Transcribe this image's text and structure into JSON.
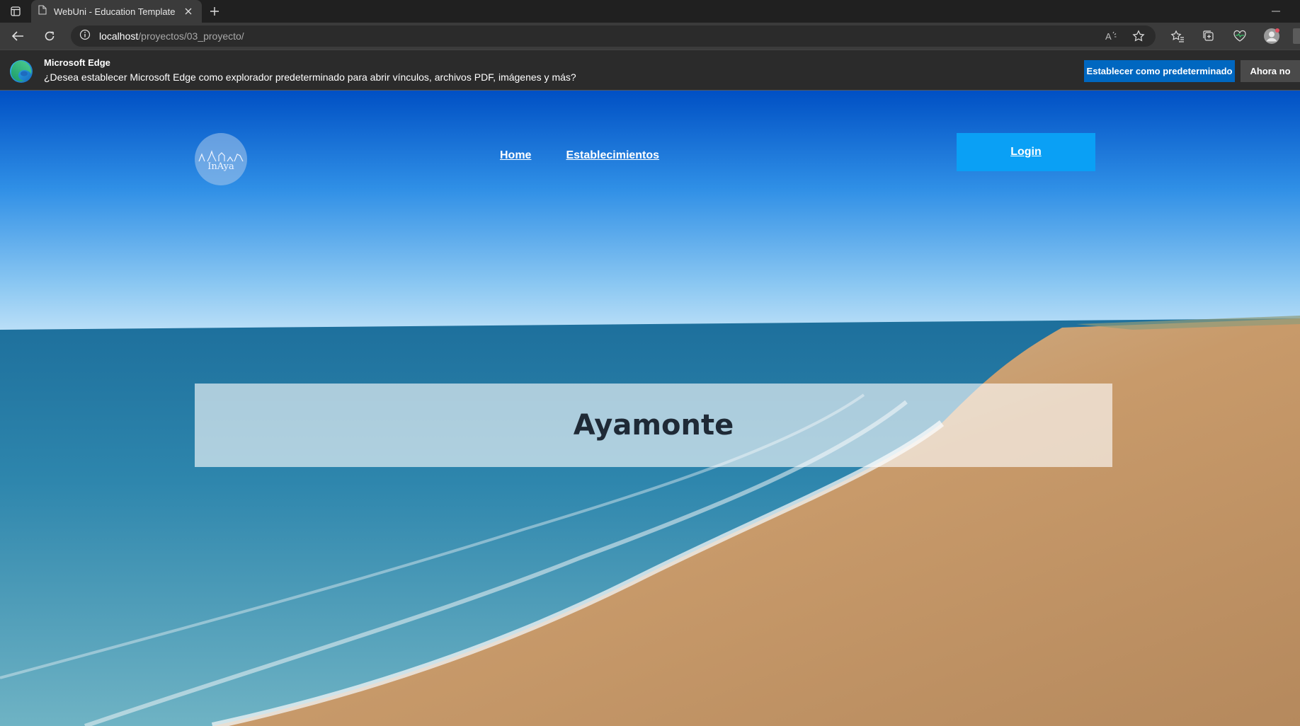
{
  "browser": {
    "tab": {
      "title": "WebUni - Education Template"
    },
    "address": {
      "host": "localhost",
      "path": "/proyectos/03_proyecto/"
    }
  },
  "infobar": {
    "title": "Microsoft Edge",
    "message": "¿Desea establecer Microsoft Edge como explorador predeterminado para abrir vínculos, archivos PDF, imágenes y más?",
    "primary_button": "Establecer como predeterminado",
    "secondary_button": "Ahora no"
  },
  "site": {
    "logo_text": "InAya",
    "nav": [
      {
        "label": "Home"
      },
      {
        "label": "Establecimientos"
      }
    ],
    "login_label": "Login",
    "hero_title": "Ayamonte"
  },
  "colors": {
    "login_button": "#0aa0f5",
    "edge_primary": "#0067c0",
    "chrome_dark": "#202020"
  }
}
